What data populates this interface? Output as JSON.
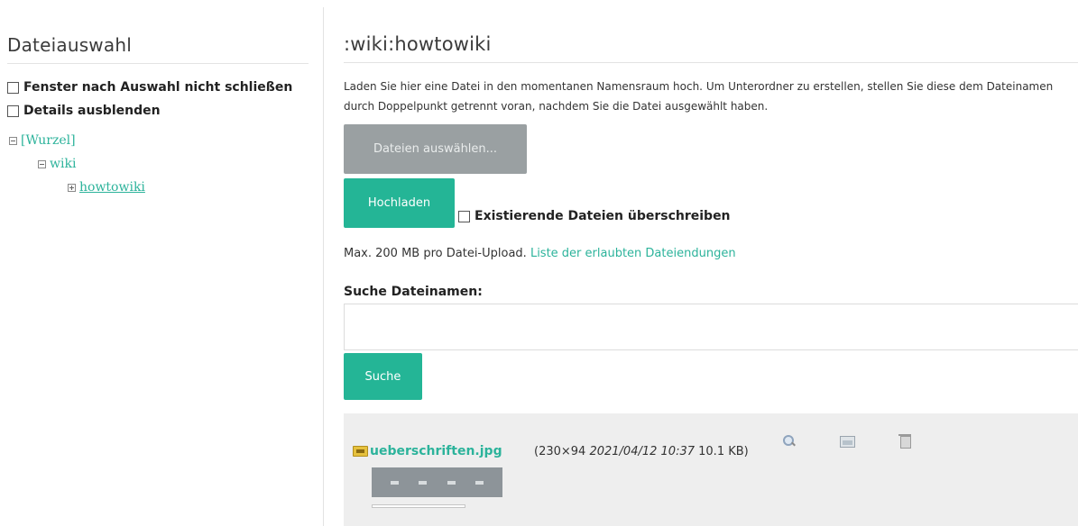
{
  "left": {
    "title": "Dateiauswahl",
    "options": {
      "keep_open": "Fenster nach Auswahl nicht schließen",
      "hide_details": "Details ausblenden"
    },
    "tree": {
      "root": "[Wurzel]",
      "wiki": "wiki",
      "howtowiki": "howtowiki"
    }
  },
  "right": {
    "title": ":wiki:howtowiki",
    "intro": "Laden Sie hier eine Datei in den momentanen Namensraum hoch. Um Unterordner zu erstellen, stellen Sie diese dem Dateinamen durch Doppelpunkt getrennt voran, nachdem Sie die Datei ausgewählt haben.",
    "choose_files": "Dateien auswählen...",
    "upload": "Hochladen",
    "overwrite": "Existierende Dateien überschreiben",
    "max_info": "Max. 200 MB pro Datei-Upload.",
    "allowed_link": "Liste der erlaubten Dateiendungen",
    "search_label": "Suche Dateinamen:",
    "search_value": "",
    "search_button": "Suche"
  },
  "results": {
    "file": {
      "name": "ueberschriften.jpg",
      "dims": "(230×94",
      "datetime": "2021/04/12 10:37",
      "size": "10.1 KB)",
      "icons": [
        "magnifier-icon",
        "image-icon",
        "delete-icon"
      ]
    }
  },
  "colors": {
    "accent": "#24b596",
    "link": "#2cb39b",
    "disabled_button": "#9aa0a2",
    "results_bg": "#eeeeee"
  }
}
